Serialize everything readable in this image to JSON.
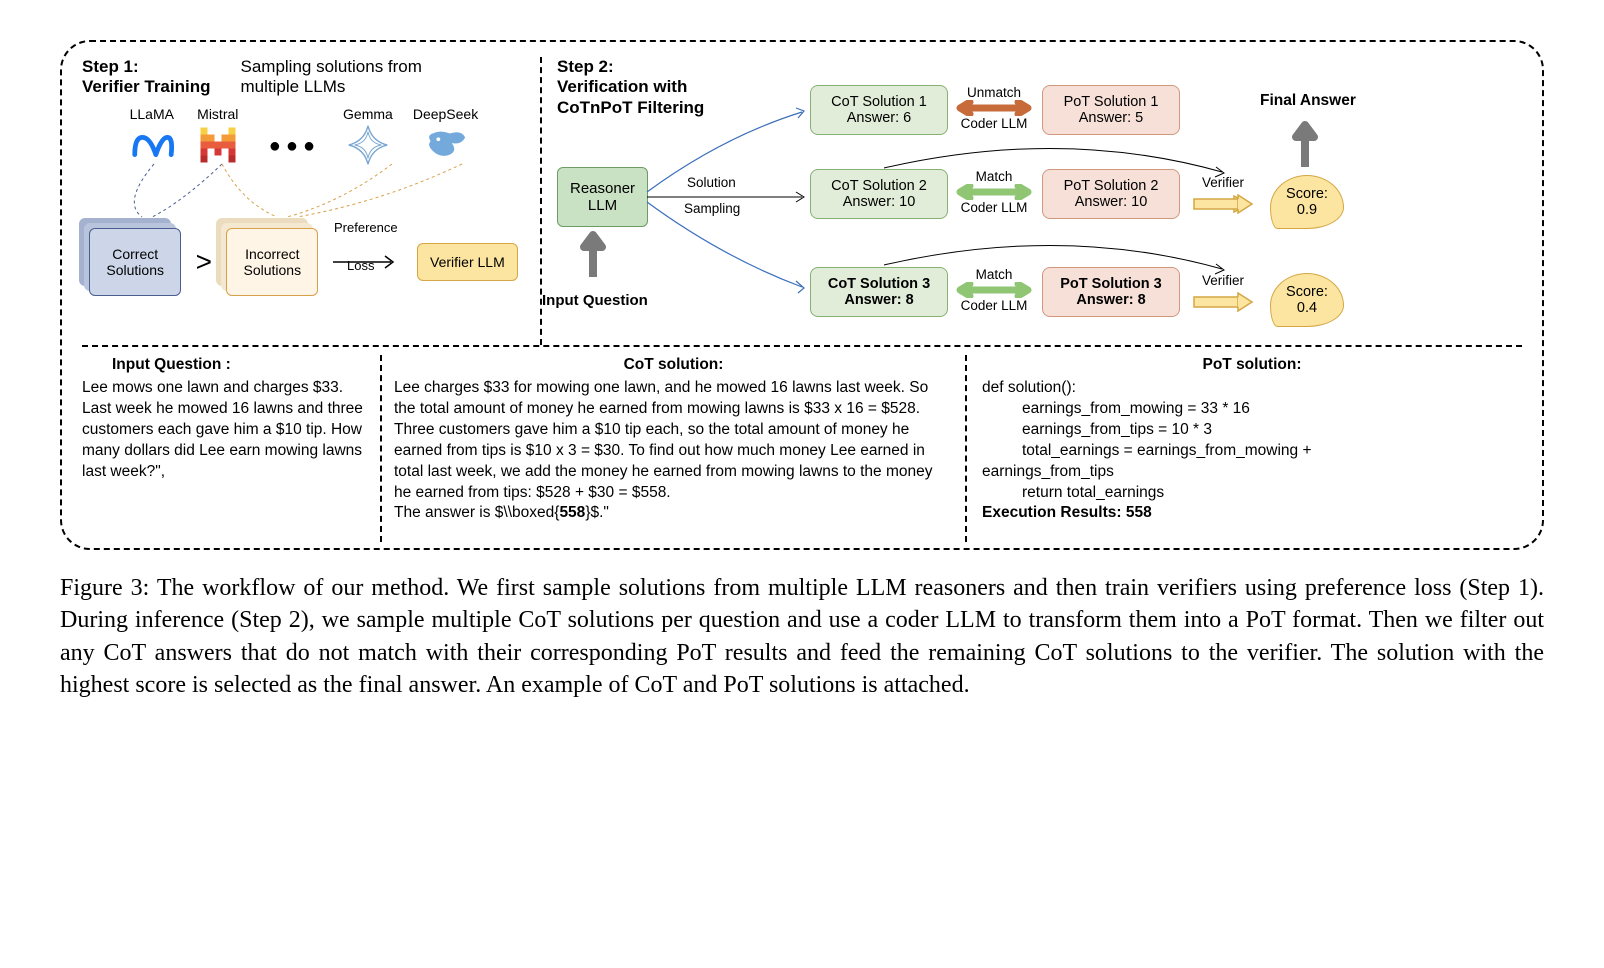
{
  "step1": {
    "title_l1": "Step 1:",
    "title_l2": "Verifier Training",
    "subtitle": "Sampling solutions from multiple LLMs",
    "llms": [
      "LLaMA",
      "Mistral",
      "Gemma",
      "DeepSeek"
    ],
    "correct": "Correct Solutions",
    "incorrect": "Incorrect Solutions",
    "gt": ">",
    "pref1": "Preference",
    "pref2": "Loss",
    "verifier": "Verifier LLM"
  },
  "step2": {
    "title_l1": "Step 2:",
    "title_l2": "Verification with",
    "title_l3": "CoTnPoT Filtering",
    "reasoner_l1": "Reasoner",
    "reasoner_l2": "LLM",
    "input_q": "Input Question",
    "sampling_l1": "Solution",
    "sampling_l2": "Sampling",
    "final": "Final Answer",
    "cot": [
      {
        "title": "CoT Solution 1",
        "answer": "Answer: 6"
      },
      {
        "title": "CoT Solution 2",
        "answer": "Answer: 10"
      },
      {
        "title": "CoT Solution 3",
        "answer": "Answer: 8"
      }
    ],
    "pot": [
      {
        "title": "PoT Solution 1",
        "answer": "Answer: 5"
      },
      {
        "title": "PoT Solution 2",
        "answer": "Answer: 10"
      },
      {
        "title": "PoT Solution 3",
        "answer": "Answer: 8"
      }
    ],
    "unmatch": "Unmatch",
    "match": "Match",
    "coder": "Coder LLM",
    "verifier": "Verifier",
    "score1": "Score: 0.9",
    "score2": "Score: 0.4"
  },
  "example": {
    "iq_title": "Input Question :",
    "iq_body": "Lee mows one lawn and charges $33. Last week he mowed 16 lawns and three customers each gave him a $10 tip. How many dollars did Lee earn mowing lawns last week?\",",
    "cot_title": "CoT solution:",
    "cot_body": "Lee charges $33 for mowing one lawn, and he mowed 16 lawns last week. So the total amount of money he earned from mowing lawns is $33 x 16 = $528. Three customers gave him a $10 tip each, so the total amount of money he earned from tips is $10 x 3 = $30. To find out how much money Lee earned in total last week, we add the money he earned from mowing lawns to the money he earned from tips: $528 + $30 = $558.",
    "cot_answer": "The answer is $\\\\boxed{558}$.\"",
    "pot_title": "PoT solution:",
    "pot_line1": "def solution():",
    "pot_line2": "earnings_from_mowing = 33 * 16",
    "pot_line3": "earnings_from_tips = 10 * 3",
    "pot_line4": "total_earnings = earnings_from_mowing + earnings_from_tips",
    "pot_line5": "return total_earnings",
    "pot_result": "Execution Results: 558"
  },
  "caption": "Figure 3: The workflow of our method. We first sample solutions from multiple LLM reasoners and then train verifiers using preference loss (Step 1). During inference (Step 2), we sample multiple CoT solutions per question and use a coder LLM to transform them into a PoT format. Then we filter out any CoT answers that do not match with their corresponding PoT results and feed the remaining CoT solutions to the verifier. The solution with the highest score is selected as the final answer. An example of CoT and PoT solutions is attached.",
  "chart_data": {
    "type": "diagram",
    "title": "Workflow of CoTnPoT verification method",
    "steps": [
      {
        "id": 1,
        "name": "Verifier Training",
        "inputs": [
          "LLaMA",
          "Mistral",
          "Gemma",
          "DeepSeek"
        ],
        "outputs": [
          "Correct Solutions",
          "Incorrect Solutions"
        ],
        "loss": "Preference Loss",
        "result": "Verifier LLM"
      },
      {
        "id": 2,
        "name": "Verification with CoTnPoT Filtering",
        "cot_answers": [
          6,
          10,
          8
        ],
        "pot_answers": [
          5,
          10,
          8
        ],
        "match": [
          false,
          true,
          true
        ],
        "scores": [
          null,
          0.9,
          0.4
        ],
        "final": 0.9
      }
    ]
  }
}
